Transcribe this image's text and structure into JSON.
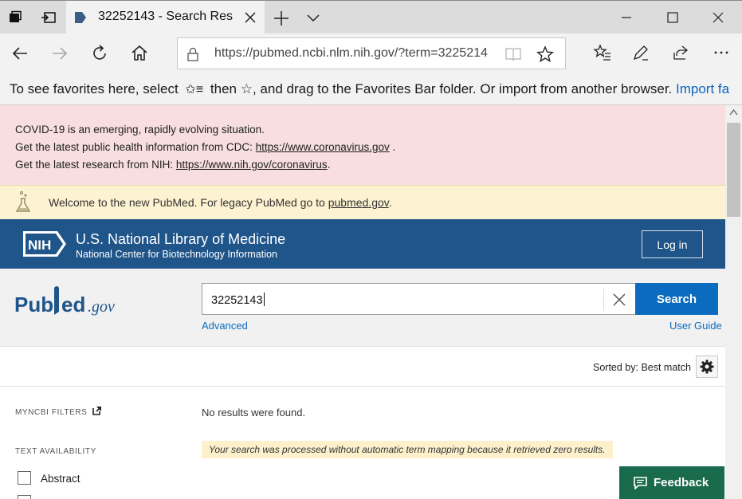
{
  "browser": {
    "tab_title": "32252143 - Search Resu",
    "url": "https://pubmed.ncbi.nlm.nih.gov/?term=3225214",
    "favorites_bar": {
      "text_before": "To see favorites here, select",
      "text_then": "then",
      "text_after": ", and drag to the Favorites Bar folder. Or import from another browser.",
      "import_link": "Import fa"
    }
  },
  "covid_banner": {
    "line1": "COVID-19 is an emerging, rapidly evolving situation.",
    "line2_text": "Get the latest public health information from CDC:",
    "line2_link": "https://www.coronavirus.gov",
    "line3_text": "Get the latest research from NIH:",
    "line3_link": "https://www.nih.gov/coronavirus"
  },
  "welcome_banner": {
    "text": "Welcome to the new PubMed. For legacy PubMed go to",
    "link": "pubmed.gov"
  },
  "header": {
    "nih_badge": "NIH",
    "title": "U.S. National Library of Medicine",
    "subtitle": "National Center for Biotechnology Information",
    "login_label": "Log in"
  },
  "search": {
    "logo_text": "PubMed.gov",
    "value": "32252143",
    "button_label": "Search",
    "advanced_link": "Advanced",
    "user_guide_link": "User Guide"
  },
  "results": {
    "sort_label": "Sorted by: Best match",
    "no_results": "No results were found.",
    "notice": "Your search was processed without automatic term mapping because it retrieved zero results."
  },
  "filters": {
    "myncbi_heading": "MYNCBI FILTERS",
    "text_availability_heading": "TEXT AVAILABILITY",
    "options": [
      "Abstract"
    ]
  },
  "feedback_label": "Feedback",
  "colors": {
    "nlm_blue": "#20558a",
    "search_blue": "#0b6bbf",
    "feedback_green": "#1a6b4d",
    "covid_pink": "#f8dede",
    "welcome_yellow": "#fdf2d1"
  }
}
